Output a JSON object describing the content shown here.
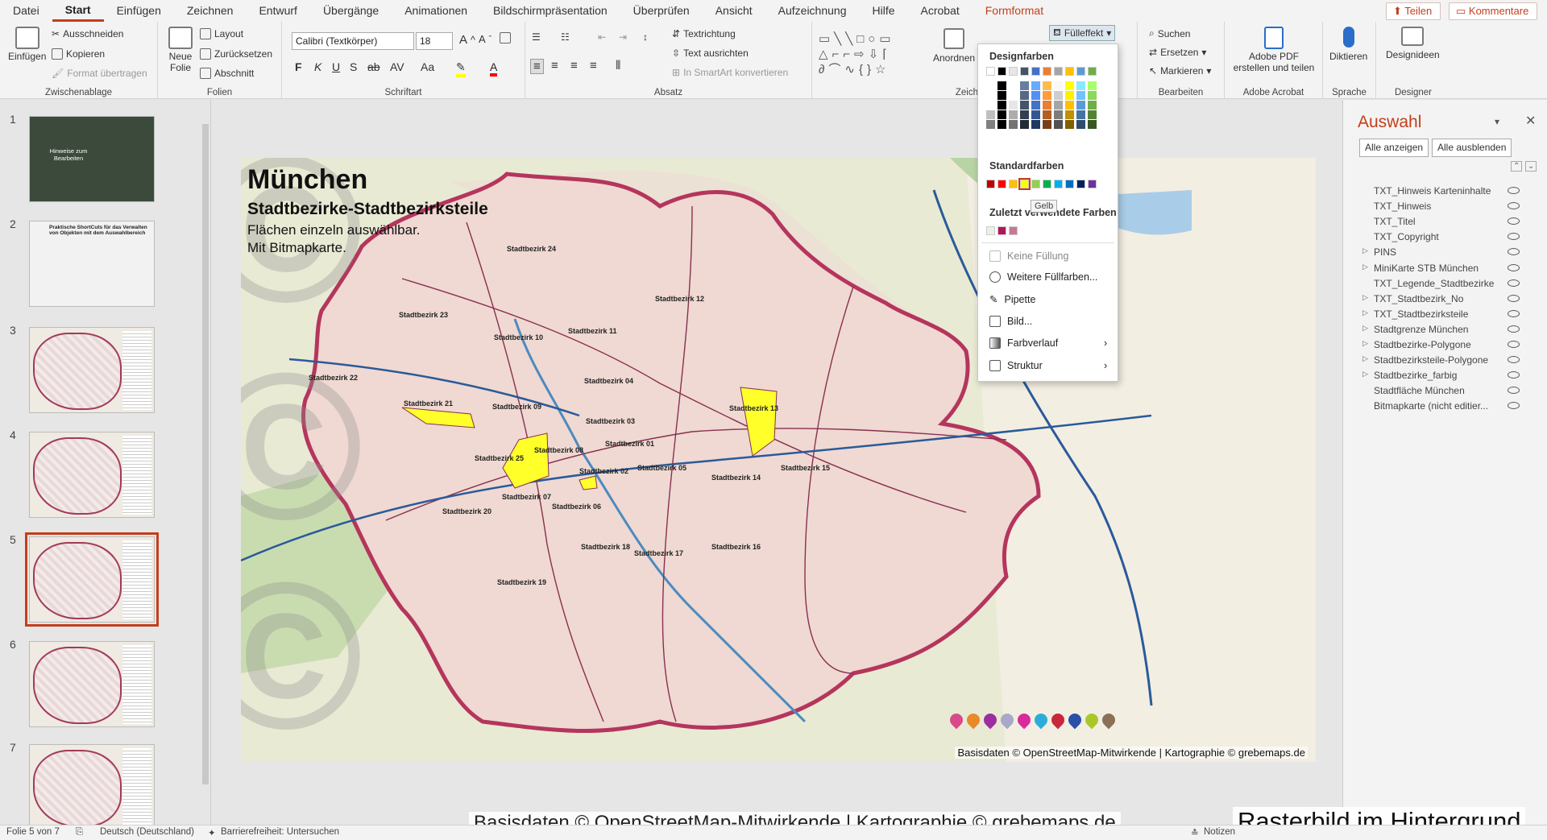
{
  "menubar": {
    "tabs": [
      {
        "label": "Datei",
        "active": false,
        "context": false
      },
      {
        "label": "Start",
        "active": true,
        "context": false
      },
      {
        "label": "Einfügen",
        "active": false,
        "context": false
      },
      {
        "label": "Zeichnen",
        "active": false,
        "context": false
      },
      {
        "label": "Entwurf",
        "active": false,
        "context": false
      },
      {
        "label": "Übergänge",
        "active": false,
        "context": false
      },
      {
        "label": "Animationen",
        "active": false,
        "context": false
      },
      {
        "label": "Bildschirmpräsentation",
        "active": false,
        "context": false
      },
      {
        "label": "Überprüfen",
        "active": false,
        "context": false
      },
      {
        "label": "Ansicht",
        "active": false,
        "context": false
      },
      {
        "label": "Aufzeichnung",
        "active": false,
        "context": false
      },
      {
        "label": "Hilfe",
        "active": false,
        "context": false
      },
      {
        "label": "Acrobat",
        "active": false,
        "context": false
      },
      {
        "label": "Formformat",
        "active": false,
        "context": true
      }
    ],
    "share": "Teilen",
    "comments": "Kommentare"
  },
  "ribbon": {
    "clipboard": {
      "label": "Zwischenablage",
      "paste": "Einfügen",
      "cut": "Ausschneiden",
      "copy": "Kopieren",
      "format_painter": "Format übertragen"
    },
    "slides": {
      "label": "Folien",
      "new_slide": "Neue Folie",
      "layout": "Layout",
      "reset": "Zurücksetzen",
      "section": "Abschnitt"
    },
    "font": {
      "label": "Schriftart",
      "family": "Calibri (Textkörper)",
      "size": "18"
    },
    "paragraph": {
      "label": "Absatz",
      "text_direction": "Textrichtung",
      "align_text": "Text ausrichten",
      "smartart": "In SmartArt konvertieren"
    },
    "drawing": {
      "label": "Zeichnen",
      "arrange": "Anordnen",
      "fill": "Fülleffekt"
    },
    "editing": {
      "label": "Bearbeiten",
      "find": "Suchen",
      "replace": "Ersetzen",
      "select": "Markieren"
    },
    "acrobat": {
      "label": "Adobe Acrobat",
      "create_pdf": "Adobe PDF erstellen und teilen"
    },
    "voice": {
      "label": "Sprache",
      "dictate": "Diktieren"
    },
    "designer": {
      "label": "Designer",
      "ideas": "Designideen"
    }
  },
  "slides": [
    {
      "num": "1",
      "caption": "Hinweise zum Bearbeiten"
    },
    {
      "num": "2",
      "caption": "Praktische ShortCuts für das Verwalten von Objekten mit dem Auswahlbereich"
    },
    {
      "num": "3",
      "caption": ""
    },
    {
      "num": "4",
      "caption": ""
    },
    {
      "num": "5",
      "caption": ""
    },
    {
      "num": "6",
      "caption": ""
    },
    {
      "num": "7",
      "caption": ""
    }
  ],
  "slide": {
    "title": "München",
    "subtitle": "Stadtbezirke-Stadtbezirksteile",
    "line1": "Flächen einzeln auswählbar.",
    "line2": "Mit Bitmapkarte.",
    "credit": "Basisdaten © OpenStreetMap-Mitwirkende | Kartographie © grebemaps.de",
    "districts": [
      {
        "label": "Stadtbezirk 24"
      },
      {
        "label": "Stadtbezirk 23"
      },
      {
        "label": "Stadtbezirk 12"
      },
      {
        "label": "Stadtbezirk 11"
      },
      {
        "label": "Stadtbezirk 10"
      },
      {
        "label": "Stadtbezirk 22"
      },
      {
        "label": "Stadtbezirk 04"
      },
      {
        "label": "Stadtbezirk 21"
      },
      {
        "label": "Stadtbezirk 09"
      },
      {
        "label": "Stadtbezirk 13"
      },
      {
        "label": "Stadtbezirk 03"
      },
      {
        "label": "Stadtbezirk 01"
      },
      {
        "label": "Stadtbezirk 25"
      },
      {
        "label": "Stadtbezirk 08"
      },
      {
        "label": "Stadtbezirk 02"
      },
      {
        "label": "Stadtbezirk 05"
      },
      {
        "label": "Stadtbezirk 15"
      },
      {
        "label": "Stadtbezirk 14"
      },
      {
        "label": "Stadtbezirk 07"
      },
      {
        "label": "Stadtbezirk 06"
      },
      {
        "label": "Stadtbezirk 20"
      },
      {
        "label": "Stadtbezirk 18"
      },
      {
        "label": "Stadtbezirk 17"
      },
      {
        "label": "Stadtbezirk 16"
      },
      {
        "label": "Stadtbezirk 19"
      }
    ],
    "pin_colors": [
      "#d94a8a",
      "#e8892a",
      "#9b2fa0",
      "#a8a8c8",
      "#d92a9b",
      "#2aaed9",
      "#c8283c",
      "#2a4fa8",
      "#a8c82a",
      "#8a7055"
    ]
  },
  "fill_menu": {
    "design_colors": "Designfarben",
    "standard_colors": "Standardfarben",
    "recent_colors": "Zuletzt verwendete Farben",
    "no_fill": "Keine Füllung",
    "more_colors": "Weitere Füllfarben...",
    "eyedropper": "Pipette",
    "picture": "Bild...",
    "gradient": "Farbverlauf",
    "texture": "Struktur",
    "tooltip": "Gelb",
    "theme_row": [
      "#ffffff",
      "#000000",
      "#e7e6e6",
      "#44546a",
      "#4472c4",
      "#ed7d31",
      "#a5a5a5",
      "#ffc000",
      "#5b9bd5",
      "#70ad47"
    ],
    "standard_row": [
      "#c00000",
      "#ff0000",
      "#ffc000",
      "#ffff00",
      "#92d050",
      "#00b050",
      "#00b0f0",
      "#0070c0",
      "#002060",
      "#7030a0"
    ],
    "recent_row": [
      "#ecefe4",
      "#b4145a",
      "#c87896"
    ]
  },
  "selection_pane": {
    "title": "Auswahl",
    "show_all": "Alle anzeigen",
    "hide_all": "Alle ausblenden",
    "items": [
      {
        "label": "TXT_Hinweis Karteninhalte",
        "group": false
      },
      {
        "label": "TXT_Hinweis",
        "group": false
      },
      {
        "label": "TXT_Titel",
        "group": false
      },
      {
        "label": "TXT_Copyright",
        "group": false
      },
      {
        "label": "PINS",
        "group": true
      },
      {
        "label": "MiniKarte STB München",
        "group": true
      },
      {
        "label": "TXT_Legende_Stadtbezirke",
        "group": false
      },
      {
        "label": "TXT_Stadtbezirk_No",
        "group": true
      },
      {
        "label": "TXT_Stadtbezirksteile",
        "group": true
      },
      {
        "label": "Stadtgrenze München",
        "group": true
      },
      {
        "label": "Stadtbezirke-Polygone",
        "group": true
      },
      {
        "label": "Stadtbezirksteile-Polygone",
        "group": true
      },
      {
        "label": "Stadtbezirke_farbig",
        "group": true
      },
      {
        "label": "Stadtfläche München",
        "group": false
      },
      {
        "label": "Bitmapkarte (nicht editier...",
        "group": false
      }
    ]
  },
  "overlays": {
    "bottom_credit": "Basisdaten © OpenStreetMap-Mitwirkende | Kartographie © grebemaps.de",
    "raster_label": "Rasterbild im Hintergrund"
  },
  "statusbar": {
    "slide_info": "Folie 5 von 7",
    "language": "Deutsch (Deutschland)",
    "accessibility": "Barrierefreiheit: Untersuchen",
    "notes": "Notizen"
  }
}
